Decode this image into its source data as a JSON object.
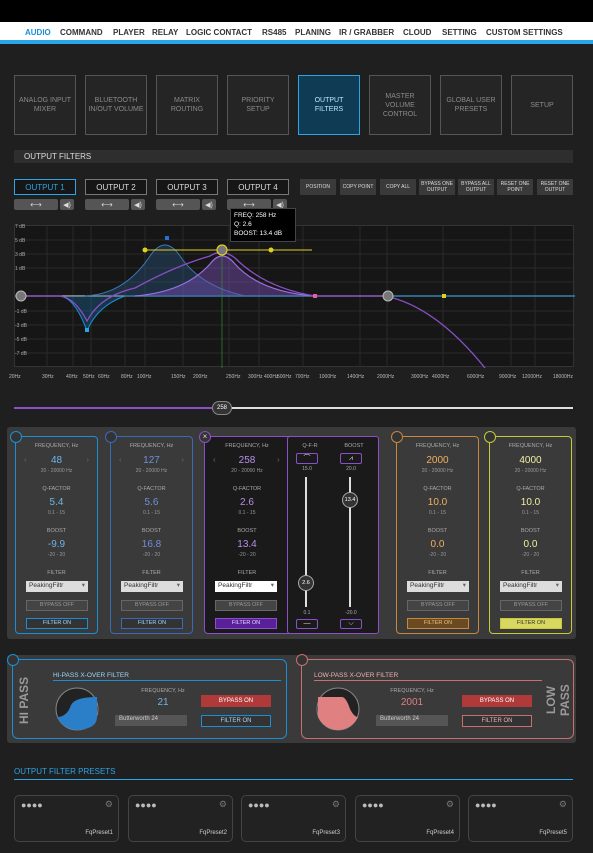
{
  "menu": [
    "AUDIO",
    "COMMAND",
    "PLAYER",
    "RELAY",
    "LOGIC CONTACT",
    "RS485",
    "PLANING",
    "IR / GRABBER",
    "CLOUD",
    "SETTING",
    "CUSTOM SETTINGS"
  ],
  "tiles": [
    "ANALOG INPUT MIXER",
    "BLUETOOTH IN/OUT VOLUME",
    "MATRIX ROUTING",
    "PRIORITY SETUP",
    "OUTPUT FILTERS",
    "MASTER VOLUME CONTROL",
    "GLOBAL USER PRESETS",
    "SETUP"
  ],
  "section_title": "OUTPUT FILTERS",
  "outputs": [
    "OUTPUT 1",
    "OUTPUT 2",
    "OUTPUT 3",
    "OUTPUT 4"
  ],
  "actions": [
    "POSITION",
    "COPY POINT",
    "COPY ALL",
    "BYPASS ONE OUTPUT",
    "BYPASS ALL OUTPUT",
    "RESET ONE POINT",
    "RESET ONE OUTPUT"
  ],
  "graph": {
    "y_labels": [
      "7 dB",
      "5 dB",
      "3 dB",
      "1 dB",
      "",
      "",
      "-1 dB",
      "-3 dB",
      "-5 dB",
      "-7 dB"
    ],
    "x_labels": [
      "20Hz",
      "30Hz",
      "40Hz",
      "50Hz",
      "60Hz",
      "80Hz",
      "100Hz",
      "150Hz",
      "200Hz",
      "250Hz",
      "300Hz",
      "400Hz",
      "500Hz",
      "700Hz",
      "1000Hz",
      "1400Hz",
      "2000Hz",
      "3000Hz",
      "4000Hz",
      "6000Hz",
      "9000Hz",
      "12000Hz",
      "18000Hz"
    ],
    "tooltip": {
      "freq": "FREQ: 258 Hz",
      "q": "Q: 2.6",
      "boost": "BOOST: 13.4 dB"
    },
    "slider_value": "258"
  },
  "bands": [
    {
      "freq": "48",
      "q": "5.4",
      "boost": "-9.9",
      "color": "#1a8fd6",
      "filter": "PeakingFiltr"
    },
    {
      "freq": "127",
      "q": "5.6",
      "boost": "16.8",
      "color": "#1a8fd6",
      "filter": "PeakingFiltr"
    },
    {
      "freq": "258",
      "q": "2.6",
      "boost": "13.4",
      "color": "#8a4fc9",
      "filter": "PeakingFiltr"
    },
    {
      "freq": "2000",
      "q": "10.0",
      "boost": "0.0",
      "color": "#c8873a",
      "filter": "PeakingFiltr"
    },
    {
      "freq": "4000",
      "q": "10.0",
      "boost": "0.0",
      "color": "#c8c83a",
      "filter": "PeakingFiltr"
    }
  ],
  "band_labels": {
    "frequency": "FREQUENCY, Hz",
    "freq_range": "20 - 20000 Hz",
    "qfactor": "Q-FACTOR",
    "q_range": "0.1 - 15",
    "boost": "BOOST",
    "boost_range": "-20 - 20",
    "filter": "FILTER",
    "bypass": "BYPASS OFF",
    "filter_on": "FILTER ON"
  },
  "qpanel": {
    "q_title": "Q-F-R",
    "boost_title": "BOOST",
    "q_max": "15.0",
    "boost_max": "20.0",
    "q_val": "2.6",
    "boost_val": "13.4",
    "q_min": "0.1",
    "boost_min": "-20.0"
  },
  "hipass": {
    "side": "HI PASS",
    "title": "HI-PASS X-OVER FILTER",
    "freq_label": "FREQUENCY, Hz",
    "freq": "21",
    "type": "Butterworth 24",
    "bypass": "BYPASS ON",
    "filter": "FILTER ON"
  },
  "lowpass": {
    "side": "LOW PASS",
    "title": "LOW-PASS X-OVER FILTER",
    "freq_label": "FREQUENCY, Hz",
    "freq": "2001",
    "type": "Butterworth 24",
    "bypass": "BYPASS ON",
    "filter": "FILTER ON"
  },
  "presets_title": "OUTPUT FILTER PRESETS",
  "presets": [
    "FqPreset1",
    "FqPreset2",
    "FqPreset3",
    "FqPreset4",
    "FqPreset5"
  ]
}
